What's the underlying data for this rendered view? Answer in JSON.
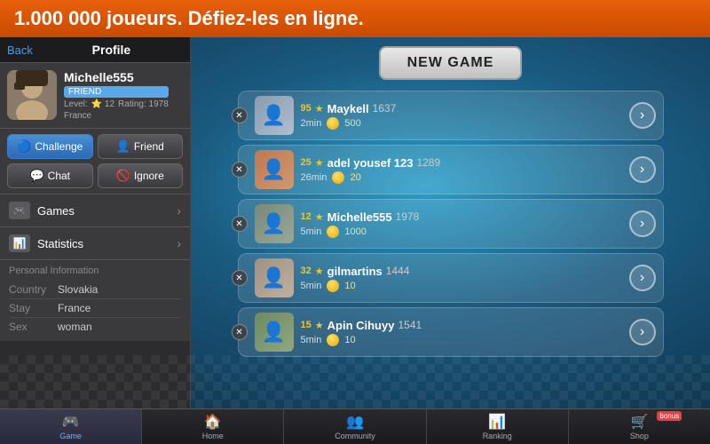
{
  "banner": {
    "text": "1.000 000 joueurs. Défiez-les en ligne."
  },
  "left_panel": {
    "back_label": "Back",
    "title": "Profile",
    "user": {
      "name": "Michelle555",
      "friend_badge": "FRIEND",
      "level": "12",
      "rating": "1978",
      "country": "France"
    },
    "actions": {
      "challenge": "Challenge",
      "friend": "Friend",
      "chat": "Chat",
      "ignore": "Ignore"
    },
    "menu": [
      {
        "label": "Games",
        "icon": "🎮"
      },
      {
        "label": "Statistics",
        "icon": "📊"
      }
    ],
    "personal_info": {
      "title": "Personal Information",
      "fields": [
        {
          "label": "Country",
          "value": "Slovakia"
        },
        {
          "label": "Stay",
          "value": "France"
        },
        {
          "label": "Sex",
          "value": "woman"
        }
      ]
    }
  },
  "game_area": {
    "new_game_label": "NEW GAME",
    "players": [
      {
        "stars": "95",
        "name": "Maykell",
        "rating": "1637",
        "time": "2min",
        "coins": "500",
        "avatar_color": "#8a9ab0"
      },
      {
        "stars": "25",
        "name": "adel yousef 123",
        "rating": "1289",
        "time": "26min",
        "coins": "20",
        "avatar_color": "#c07850"
      },
      {
        "stars": "12",
        "name": "Michelle555",
        "rating": "1978",
        "time": "5min",
        "coins": "1000",
        "avatar_color": "#7a8878"
      },
      {
        "stars": "32",
        "name": "gilmartins",
        "rating": "1444",
        "time": "5min",
        "coins": "10",
        "avatar_color": "#a09080"
      },
      {
        "stars": "15",
        "name": "Apin Cihuyy",
        "rating": "1541",
        "time": "5min",
        "coins": "10",
        "avatar_color": "#708860"
      }
    ]
  },
  "bottom_nav": {
    "items": [
      {
        "label": "Game",
        "icon": "🎮",
        "active": true
      },
      {
        "label": "Home",
        "icon": "🏠",
        "active": false
      },
      {
        "label": "Community",
        "icon": "👥",
        "active": false
      },
      {
        "label": "Ranking",
        "icon": "📊",
        "active": false
      },
      {
        "label": "Shop",
        "icon": "🛒",
        "active": false,
        "badge": "bonus"
      }
    ]
  }
}
